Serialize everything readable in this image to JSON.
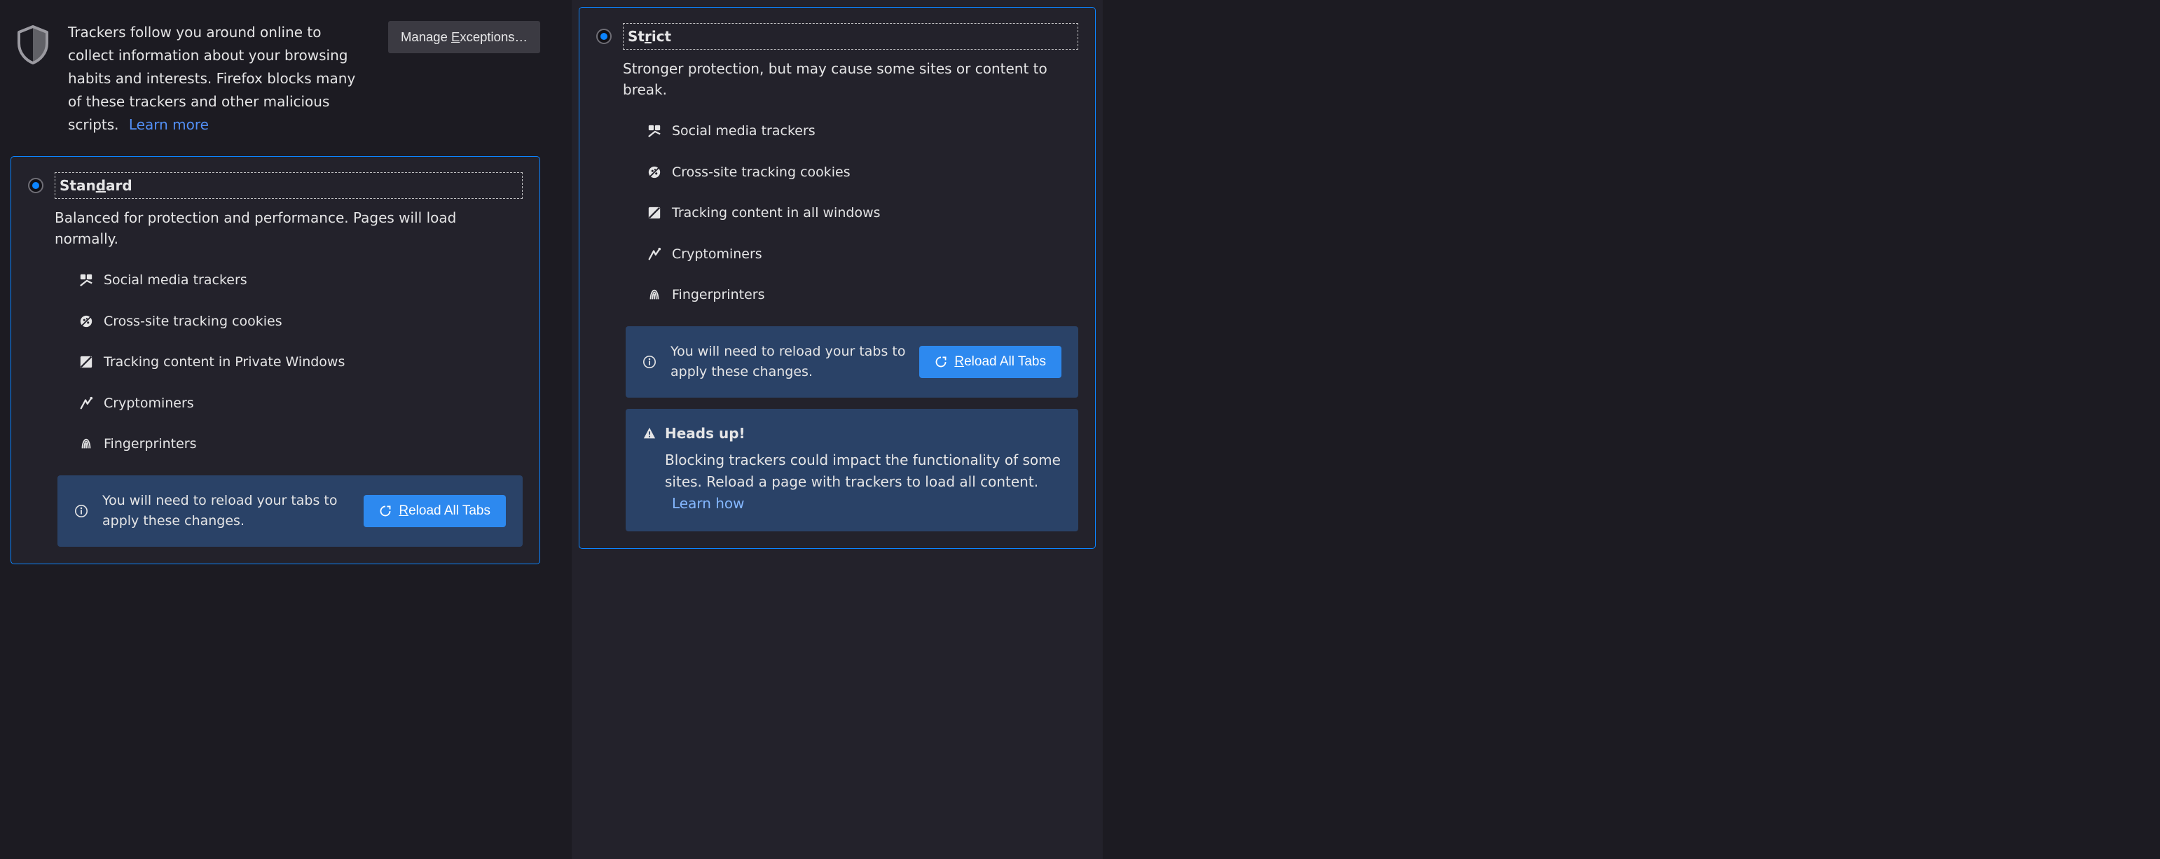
{
  "intro": {
    "text": "Trackers follow you around online to collect information about your browsing habits and interests. Firefox blocks many of these trackers and other malicious scripts.",
    "learn_more": "Learn more",
    "manage_exceptions": "Manage Exceptions…"
  },
  "standard": {
    "title": "Standard",
    "desc": "Balanced for protection and performance. Pages will load normally.",
    "items": {
      "social": "Social media trackers",
      "cookies": "Cross-site tracking cookies",
      "content": "Tracking content in Private Windows",
      "crypto": "Cryptominers",
      "finger": "Fingerprinters"
    }
  },
  "strict": {
    "title": "Strict",
    "desc": "Stronger protection, but may cause some sites or content to break.",
    "items": {
      "social": "Social media trackers",
      "cookies": "Cross-site tracking cookies",
      "content": "Tracking content in all windows",
      "crypto": "Cryptominers",
      "finger": "Fingerprinters"
    }
  },
  "notice": {
    "text": "You will need to reload your tabs to apply these changes.",
    "button": "Reload All Tabs"
  },
  "headsup": {
    "title": "Heads up!",
    "body": "Blocking trackers could impact the functionality of some sites. Reload a page with trackers to load all content.",
    "learn_how": "Learn how"
  }
}
